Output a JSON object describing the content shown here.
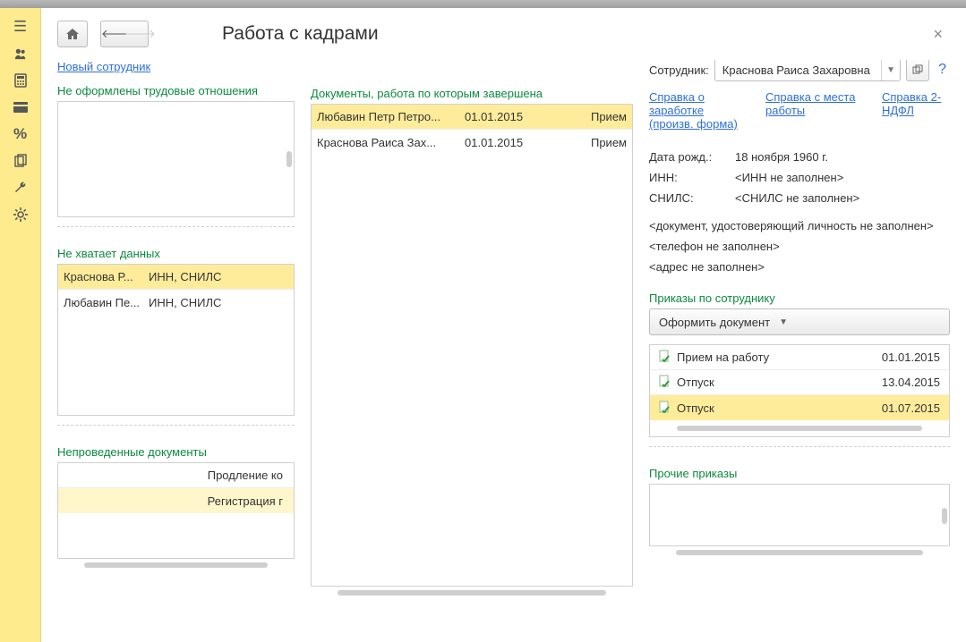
{
  "page_title": "Работа с кадрами",
  "new_employee_link": "Новый сотрудник",
  "sections": {
    "no_relations": "Не оформлены трудовые отношения",
    "missing_data": "Не хватает данных",
    "unposted": "Непроведенные документы",
    "completed": "Документы, работа по которым завершена",
    "orders": "Приказы по сотруднику",
    "other_orders": "Прочие приказы"
  },
  "missing_data_rows": [
    {
      "name": "Краснова Р...",
      "fields": "ИНН, СНИЛС",
      "sel": true
    },
    {
      "name": "Любавин Пе...",
      "fields": "ИНН, СНИЛС",
      "sel": false
    }
  ],
  "unposted_rows": [
    {
      "text": "Продление ко",
      "sel": false
    },
    {
      "text": "Регистрация г",
      "sel": true
    }
  ],
  "completed_rows": [
    {
      "name": "Любавин Петр Петро...",
      "date": "01.01.2015",
      "type": "Прием",
      "sel": true
    },
    {
      "name": "Краснова Раиса Зах...",
      "date": "01.01.2015",
      "type": "Прием",
      "sel": false
    }
  ],
  "right": {
    "label_employee": "Сотрудник:",
    "employee_value": "Краснова Раиса Захаровна",
    "links": {
      "salary_cert": "Справка о заработке (произв. форма)",
      "work_cert": "Справка с места работы",
      "ndfl": "Справка 2-НДФЛ"
    },
    "kv": [
      {
        "k": "Дата рожд.:",
        "v": "18 ноября 1960 г."
      },
      {
        "k": "ИНН:",
        "v": "<ИНН не заполнен>"
      },
      {
        "k": "СНИЛС:",
        "v": "<СНИЛС не заполнен>"
      }
    ],
    "notes": [
      "<документ, удостоверяющий личность не заполнен>",
      "<телефон не заполнен>",
      "<адрес не заполнен>"
    ],
    "create_doc": "Оформить документ",
    "orders": [
      {
        "name": "Прием на работу",
        "date": "01.01.2015",
        "sel": false
      },
      {
        "name": "Отпуск",
        "date": "13.04.2015",
        "sel": false
      },
      {
        "name": "Отпуск",
        "date": "01.07.2015",
        "sel": true
      }
    ]
  }
}
